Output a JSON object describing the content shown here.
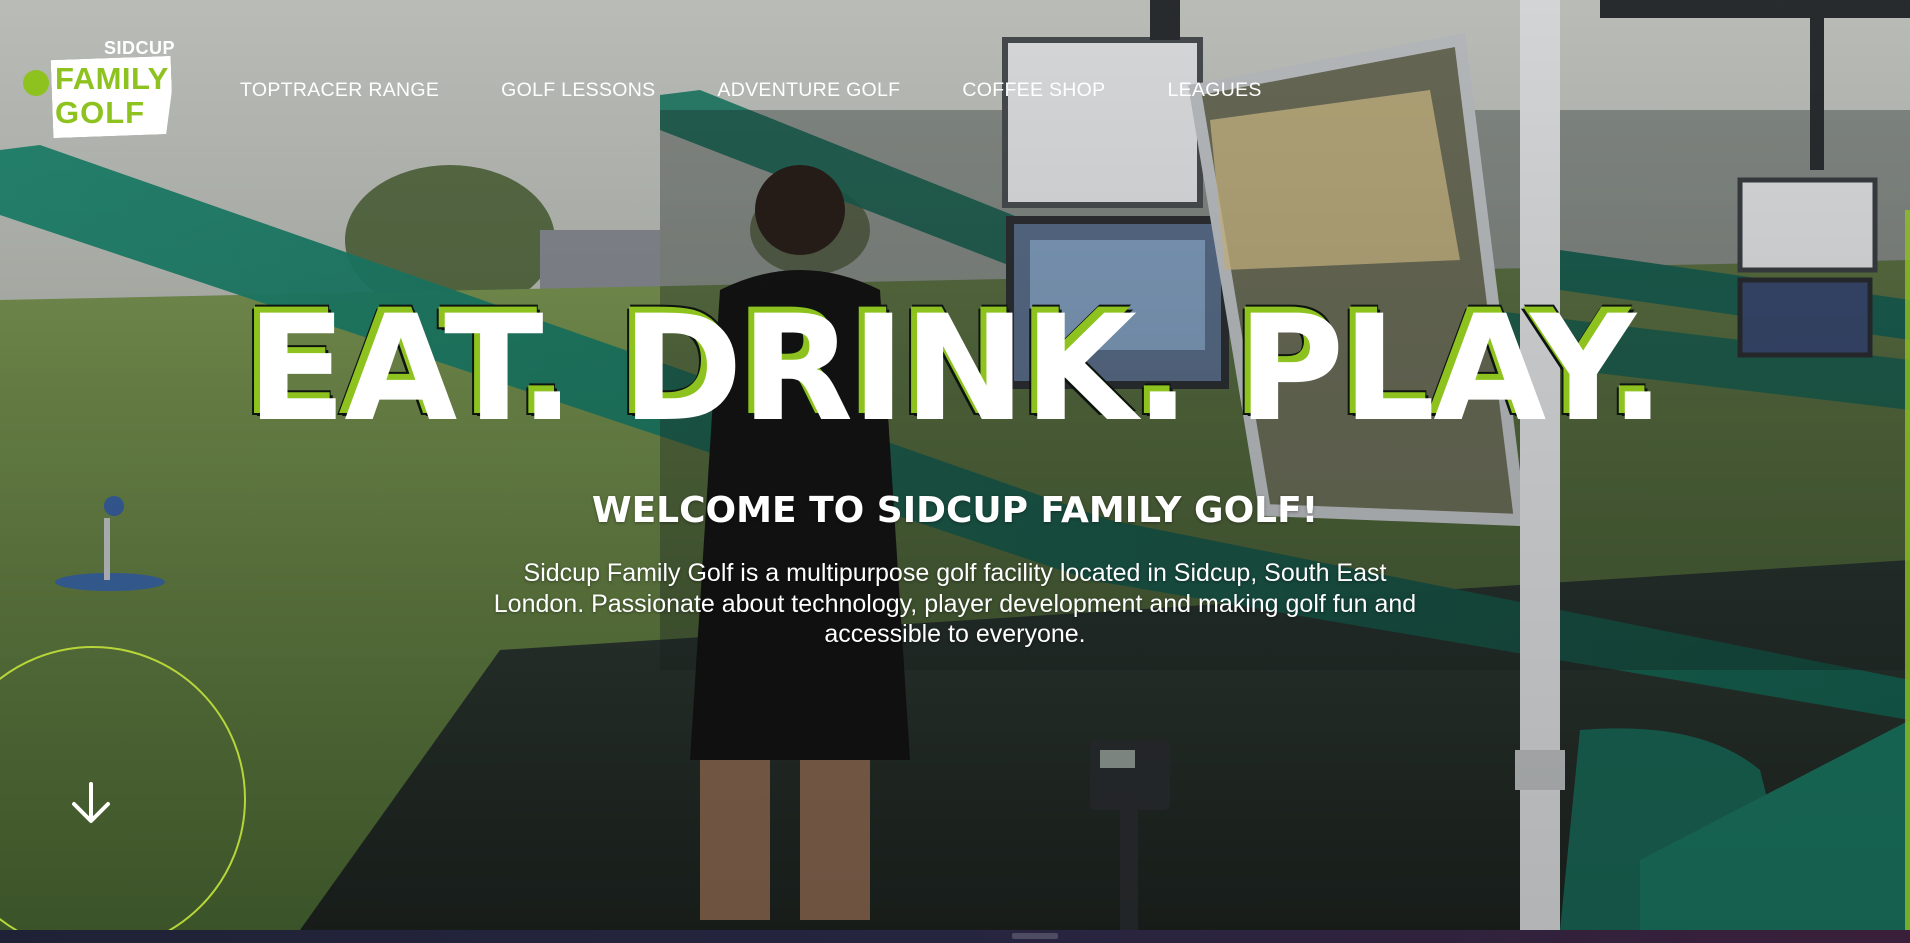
{
  "logo": {
    "sidcup": "SIDCUP",
    "family": "FAMILY",
    "golf": "GOLF",
    "accent_color": "#8dc21f"
  },
  "nav": {
    "items": [
      {
        "label": "TOPTRACER RANGE"
      },
      {
        "label": "GOLF LESSONS"
      },
      {
        "label": "ADVENTURE GOLF"
      },
      {
        "label": "COFFEE SHOP"
      },
      {
        "label": "LEAGUES"
      }
    ]
  },
  "hero": {
    "headline": "EAT. DRINK. PLAY.",
    "welcome": "WELCOME TO SIDCUP FAMILY GOLF!",
    "description": "Sidcup Family Golf is a multipurpose golf facility located in Sidcup, South East London. Passionate about technology, player development and making golf fun and accessible to everyone.",
    "scroll_icon": "arrow-down-icon"
  },
  "colors": {
    "brand_green": "#8dc21f",
    "net_teal": "#1e7a68"
  }
}
